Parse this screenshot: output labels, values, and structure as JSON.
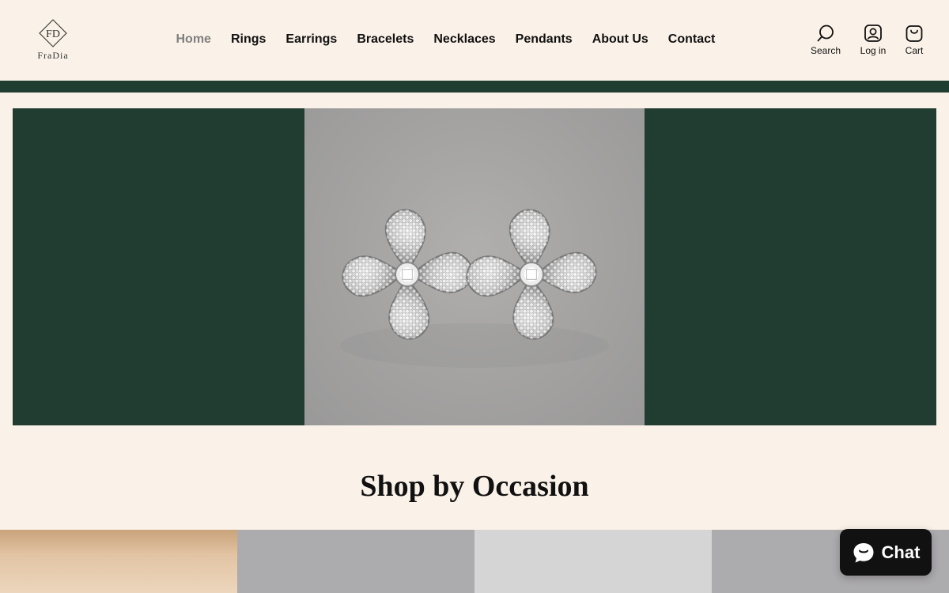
{
  "brand": {
    "name": "FraDia",
    "monogram": "FD"
  },
  "nav": {
    "items": [
      {
        "label": "Home",
        "active": true
      },
      {
        "label": "Rings"
      },
      {
        "label": "Earrings"
      },
      {
        "label": "Bracelets"
      },
      {
        "label": "Necklaces"
      },
      {
        "label": "Pendants"
      },
      {
        "label": "About Us"
      },
      {
        "label": "Contact"
      }
    ]
  },
  "utilities": {
    "search": {
      "label": "Search",
      "icon": "search-icon"
    },
    "login": {
      "label": "Log in",
      "icon": "account-icon"
    },
    "cart": {
      "label": "Cart",
      "icon": "bag-icon"
    }
  },
  "hero": {
    "image": "diamond-clover-earrings"
  },
  "shop_by_occasion": {
    "title": "Shop by Occasion"
  },
  "chat": {
    "label": "Chat",
    "icon": "chat-bubble-icon"
  },
  "colors": {
    "background": "#faf2e8",
    "accent_green": "#213d31",
    "text": "#111111",
    "muted": "#7f7f7f"
  }
}
